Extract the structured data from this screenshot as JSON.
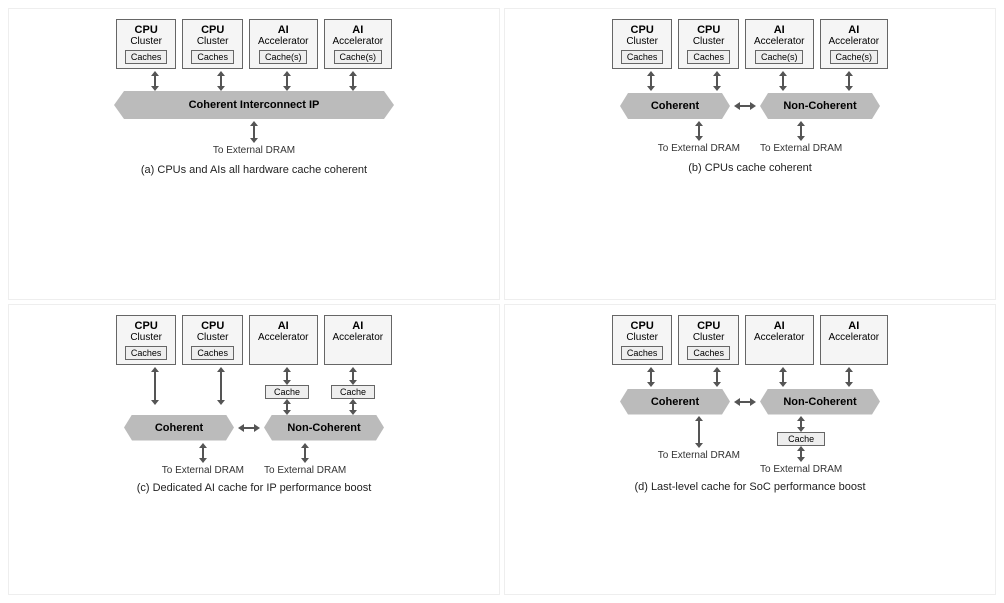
{
  "diagrams": [
    {
      "id": "a",
      "units": [
        {
          "title": "CPU",
          "sub": "Cluster",
          "cache": "Caches"
        },
        {
          "title": "CPU",
          "sub": "Cluster",
          "cache": "Caches"
        },
        {
          "title": "AI",
          "sub": "Accelerator",
          "cache": "Cache(s)"
        },
        {
          "title": "AI",
          "sub": "Accelerator",
          "cache": "Cache(s)"
        }
      ],
      "interconnect": "Coherent Interconnect IP",
      "drams": [
        "To External DRAM"
      ],
      "caption": "(a) CPUs and AIs all hardware cache coherent"
    },
    {
      "id": "b",
      "units": [
        {
          "title": "CPU",
          "sub": "Cluster",
          "cache": "Caches"
        },
        {
          "title": "CPU",
          "sub": "Cluster",
          "cache": "Caches"
        },
        {
          "title": "AI",
          "sub": "Accelerator",
          "cache": "Cache(s)"
        },
        {
          "title": "AI",
          "sub": "Accelerator",
          "cache": "Cache(s)"
        }
      ],
      "left_banner": "Coherent",
      "right_banner": "Non-Coherent",
      "drams": [
        "To External DRAM",
        "To External DRAM"
      ],
      "caption": "(b) CPUs cache coherent"
    },
    {
      "id": "c",
      "units": [
        {
          "title": "CPU",
          "sub": "Cluster",
          "cache": "Caches"
        },
        {
          "title": "CPU",
          "sub": "Cluster",
          "cache": "Caches"
        },
        {
          "title": "AI",
          "sub": "Accelerator",
          "cache": null
        },
        {
          "title": "AI",
          "sub": "Accelerator",
          "cache": null
        }
      ],
      "ai_extra_cache": "Cache",
      "left_banner": "Coherent",
      "right_banner": "Non-Coherent",
      "drams": [
        "To External DRAM",
        "To External DRAM"
      ],
      "caption": "(c) Dedicated AI cache for IP performance boost"
    },
    {
      "id": "d",
      "units": [
        {
          "title": "CPU",
          "sub": "Cluster",
          "cache": "Caches"
        },
        {
          "title": "CPU",
          "sub": "Cluster",
          "cache": "Caches"
        },
        {
          "title": "AI",
          "sub": "Accelerator",
          "cache": null
        },
        {
          "title": "AI",
          "sub": "Accelerator",
          "cache": null
        }
      ],
      "shared_cache": "Cache",
      "left_banner": "Coherent",
      "right_banner": "Non-Coherent",
      "drams": [
        "To External DRAM",
        "To External DRAM"
      ],
      "caption": "(d) Last-level cache for SoC performance boost"
    }
  ],
  "labels": {
    "to_external_dram": "To External DRAM",
    "coherent": "Coherent",
    "non_coherent": "Non-Coherent",
    "cache": "Cache",
    "caches": "Caches",
    "cache_s": "Cache(s)",
    "cpu": "CPU",
    "cluster": "Cluster",
    "ai": "AI",
    "accelerator": "Accelerator",
    "coherent_interconnect_ip": "Coherent Interconnect IP"
  }
}
